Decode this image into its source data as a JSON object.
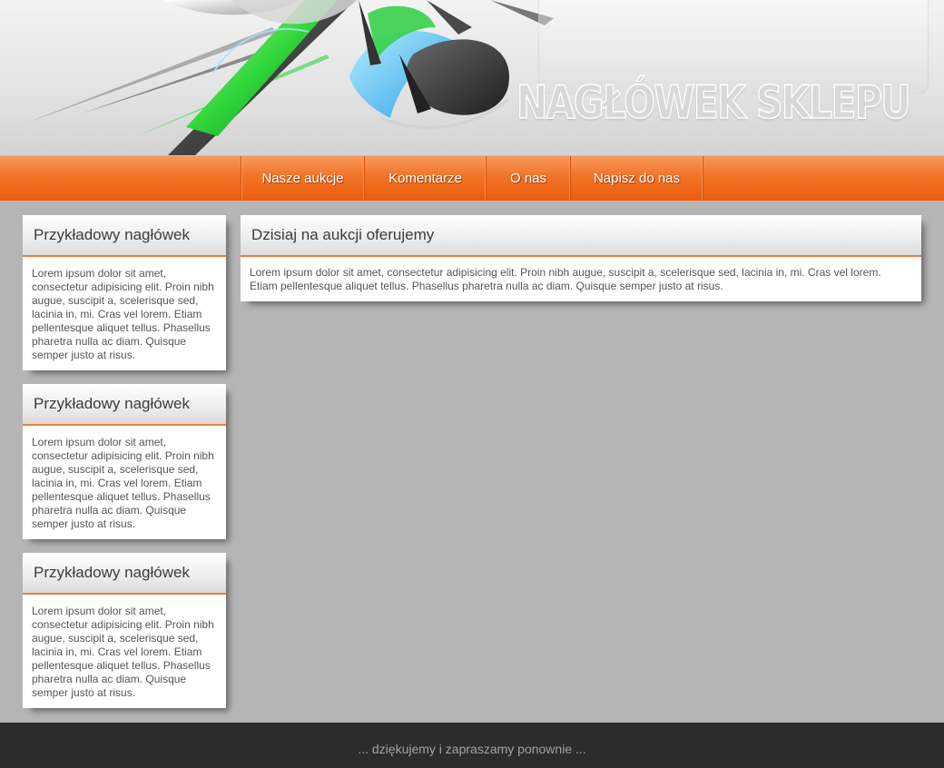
{
  "header": {
    "shop_title": "NAGŁÓWEK SKLEPU"
  },
  "nav": {
    "items": [
      {
        "label": "Nasze aukcje"
      },
      {
        "label": "Komentarze"
      },
      {
        "label": "O nas"
      },
      {
        "label": "Napisz do nas"
      }
    ]
  },
  "sidebar": {
    "boxes": [
      {
        "title": "Przykładowy nagłówek",
        "text": "Lorem ipsum dolor sit amet, consectetur adipisicing elit. Proin nibh augue, suscipit a, scelerisque sed, lacinia in, mi. Cras vel lorem. Etiam pellentesque aliquet tellus. Phasellus pharetra nulla ac diam. Quisque semper justo at risus."
      },
      {
        "title": "Przykładowy nagłówek",
        "text": "Lorem ipsum dolor sit amet, consectetur adipisicing elit. Proin nibh augue, suscipit a, scelerisque sed, lacinia in, mi. Cras vel lorem. Etiam pellentesque aliquet tellus. Phasellus pharetra nulla ac diam. Quisque semper justo at risus."
      },
      {
        "title": "Przykładowy nagłówek",
        "text": "Lorem ipsum dolor sit amet, consectetur adipisicing elit. Proin nibh augue, suscipit a, scelerisque sed, lacinia in, mi. Cras vel lorem. Etiam pellentesque aliquet tellus. Phasellus pharetra nulla ac diam. Quisque semper justo at risus."
      }
    ]
  },
  "main": {
    "title": "Dzisiaj na aukcji oferujemy",
    "text": "Lorem ipsum dolor sit amet, consectetur adipisicing elit. Proin nibh augue, suscipit a, scelerisque sed, lacinia in, mi. Cras vel lorem. Etiam pellentesque aliquet tellus. Phasellus pharetra nulla ac diam. Quisque semper justo at risus."
  },
  "footer": {
    "text": "... dziękujemy i zapraszamy ponownie ..."
  },
  "colors": {
    "accent": "#f27327",
    "page_background": "#b5b5b5",
    "footer_background": "#2c2c2c"
  }
}
